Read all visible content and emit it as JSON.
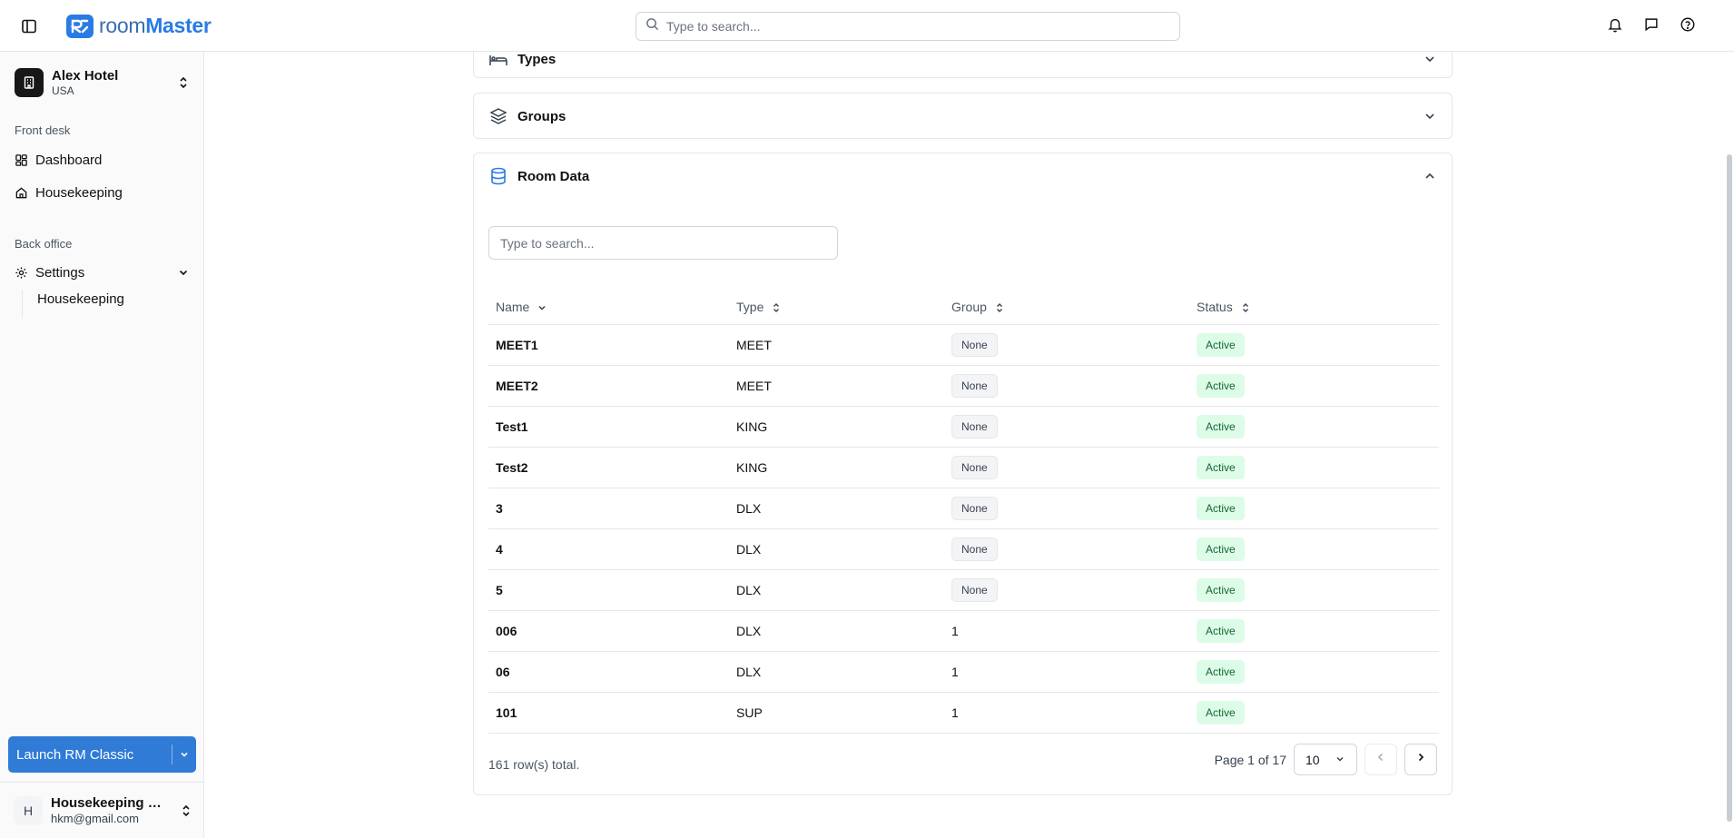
{
  "header": {
    "logo_prefix": "room",
    "logo_suffix": "Master",
    "search_placeholder": "Type to search..."
  },
  "sidebar": {
    "hotel": {
      "name": "Alex Hotel",
      "country": "USA"
    },
    "front_desk_label": "Front desk",
    "front_desk_items": [
      {
        "label": "Dashboard",
        "icon": "dashboard-icon"
      },
      {
        "label": "Housekeeping",
        "icon": "home-icon"
      }
    ],
    "back_office_label": "Back office",
    "settings_label": "Settings",
    "settings_subitems": [
      {
        "label": "Housekeeping"
      }
    ],
    "launch_button_label": "Launch RM Classic",
    "user": {
      "initial": "H",
      "name": "Housekeeping M...",
      "email": "hkm@gmail.com"
    }
  },
  "sections": {
    "types_title": "Types",
    "groups_title": "Groups",
    "room_data_title": "Room Data"
  },
  "room_table": {
    "search_placeholder": "Type to search...",
    "columns": [
      "Name",
      "Type",
      "Group",
      "Status"
    ],
    "rows": [
      {
        "name": "MEET1",
        "type": "MEET",
        "group": "None",
        "status": "Active"
      },
      {
        "name": "MEET2",
        "type": "MEET",
        "group": "None",
        "status": "Active"
      },
      {
        "name": "Test1",
        "type": "KING",
        "group": "None",
        "status": "Active"
      },
      {
        "name": "Test2",
        "type": "KING",
        "group": "None",
        "status": "Active"
      },
      {
        "name": "3",
        "type": "DLX",
        "group": "None",
        "status": "Active"
      },
      {
        "name": "4",
        "type": "DLX",
        "group": "None",
        "status": "Active"
      },
      {
        "name": "5",
        "type": "DLX",
        "group": "None",
        "status": "Active"
      },
      {
        "name": "006",
        "type": "DLX",
        "group": "1",
        "status": "Active"
      },
      {
        "name": "06",
        "type": "DLX",
        "group": "1",
        "status": "Active"
      },
      {
        "name": "101",
        "type": "SUP",
        "group": "1",
        "status": "Active"
      }
    ],
    "row_total_text": "161 row(s) total.",
    "pagination": {
      "page_text": "Page 1 of 17",
      "page_size": "10"
    }
  },
  "colors": {
    "brand": "#2a7be4",
    "launch_button": "#2f7bd6",
    "active_badge_bg": "#dcfce7",
    "active_badge_text": "#166534"
  }
}
